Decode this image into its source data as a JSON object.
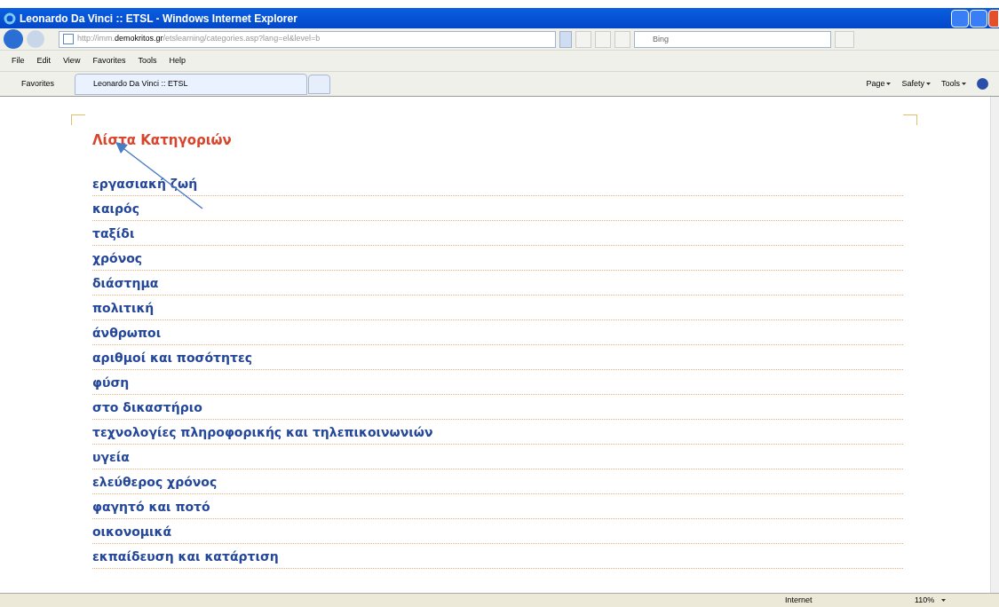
{
  "window": {
    "title": "Leonardo Da Vinci :: ETSL - Windows Internet Explorer"
  },
  "address_bar": {
    "url_prefix": "http://imm.",
    "url_domain": "demokritos.gr",
    "url_path": "/etslearning/categories.asp?lang=el&level=b"
  },
  "search": {
    "placeholder": "Bing"
  },
  "menu": [
    "File",
    "Edit",
    "View",
    "Favorites",
    "Tools",
    "Help"
  ],
  "favorites_bar": {
    "favorites": "Favorites",
    "tabs": [
      {
        "label": "Leonardo Da Vinci :: ETSL",
        "selected": true
      }
    ],
    "commands": [
      "Page",
      "Safety",
      "Tools"
    ]
  },
  "page": {
    "heading": "Λίστα Κατηγοριών",
    "categories": [
      "εργασιακή ζωή",
      "καιρός",
      "ταξίδι",
      "χρόνος",
      "διάστημα",
      "πολιτική",
      "άνθρωποι",
      "αριθμοί και ποσότητες",
      "φύση",
      "στο δικαστήριο",
      "τεχνολογίες πληροφορικής και τηλεπικοινωνιών",
      "υγεία",
      "ελεύθερος χρόνος",
      "φαγητό και ποτό",
      "οικονομικά",
      "εκπαίδευση και κατάρτιση"
    ]
  },
  "status_bar": {
    "zone": "Internet",
    "zoom": "110%"
  }
}
